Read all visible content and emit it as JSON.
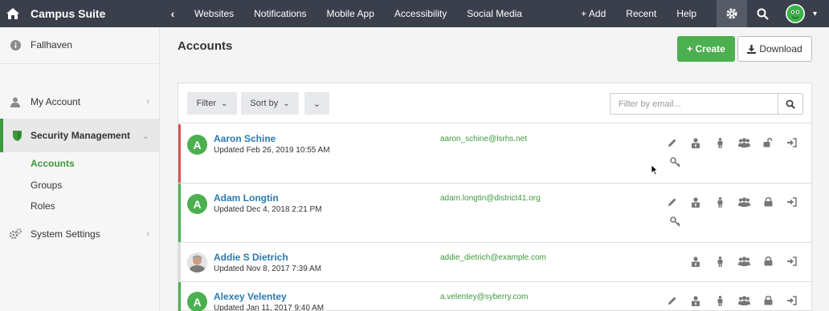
{
  "topbar": {
    "brand": "Campus Suite",
    "nav": [
      "Websites",
      "Notifications",
      "Mobile App",
      "Accessibility",
      "Social Media"
    ],
    "right_links": [
      "+ Add",
      "Recent",
      "Help"
    ]
  },
  "sidebar": {
    "school": "Fallhaven",
    "my_account": "My Account",
    "security_management": "Security Management",
    "sub_items": [
      "Accounts",
      "Groups",
      "Roles"
    ],
    "system_settings": "System Settings"
  },
  "main": {
    "title": "Accounts",
    "create_label": "+ Create",
    "download_label": "Download"
  },
  "toolbar": {
    "filter_label": "Filter",
    "sort_label": "Sort by",
    "email_placeholder": "Filter by email..."
  },
  "accounts": [
    {
      "initial": "A",
      "name": "Aaron Schine",
      "updated": "Updated Feb 26, 2019 10:55 AM",
      "email": "aaron_schine@lsrhs.net",
      "status_color": "#d9534f"
    },
    {
      "initial": "A",
      "name": "Adam Longtin",
      "updated": "Updated Dec 4, 2018 2:21 PM",
      "email": "adam.longtin@district41.org",
      "status_color": "#4caf50"
    },
    {
      "initial": "",
      "name": "Addie S Dietrich",
      "updated": "Updated Nov 8, 2017 7:39 AM",
      "email": "addie_dietrich@example.com",
      "status_color": "#dddddd"
    },
    {
      "initial": "A",
      "name": "Alexey Velentey",
      "updated": "Updated Jan 11, 2017 9:40 AM",
      "email": "a.velentey@syberry.com",
      "status_color": "#4caf50"
    }
  ],
  "colors": {
    "accent": "#4caf50",
    "topbar": "#3a3f4b",
    "link": "#2a7ab0"
  }
}
